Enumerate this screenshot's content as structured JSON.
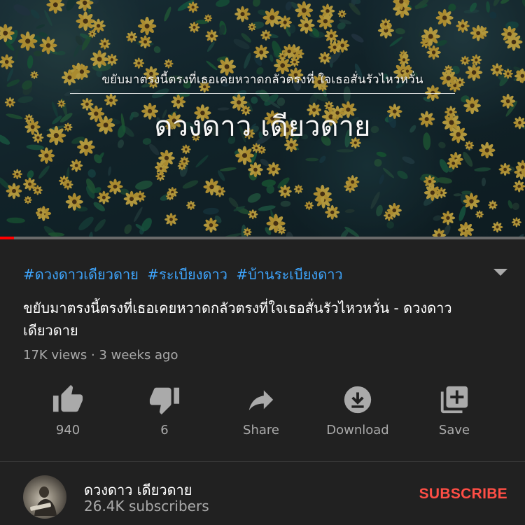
{
  "video": {
    "overlay_title": "ขยับมาตรงนี้ตรงที่เธอเคยหวาดกลัวตรงที่ ใจเธอสั่นรัวไหวหวั่น",
    "overlay_artist": "ดวงดาว เดียวดาย",
    "progress_fraction": 0.027
  },
  "hashtags": [
    "#ดวงดาวเดียวดาย",
    "#ระเบียงดาว",
    "#บ้านระเบียงดาว"
  ],
  "title": "ขยับมาตรงนี้ตรงที่เธอเคยหวาดกลัวตรงที่ใจเธอสั่นรัวไหวหวั่น - ดวงดาว เดียวดาย",
  "stats": "17K views · 3 weeks ago",
  "actions": {
    "like": {
      "label": "940",
      "icon": "thumbs-up-icon"
    },
    "dislike": {
      "label": "6",
      "icon": "thumbs-down-icon"
    },
    "share": {
      "label": "Share",
      "icon": "share-icon"
    },
    "download": {
      "label": "Download",
      "icon": "download-icon"
    },
    "save": {
      "label": "Save",
      "icon": "add-to-playlist-icon"
    }
  },
  "channel": {
    "name": "ดวงดาว เดียวดาย",
    "subscribers": "26.4K subscribers",
    "subscribe_label": "SUBSCRIBE"
  },
  "colors": {
    "background": "#212121",
    "hashtag": "#3ea6ff",
    "secondary_text": "#aaaaaa",
    "subscribe": "#ff4e45",
    "progress": "#ff0000"
  }
}
